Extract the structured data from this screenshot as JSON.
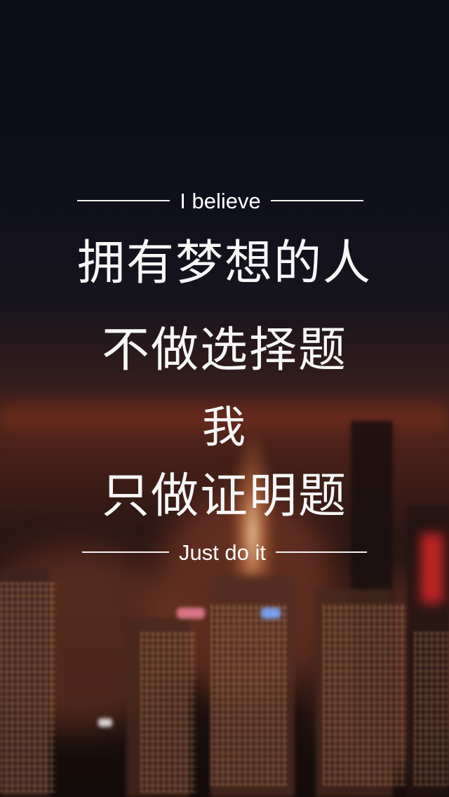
{
  "wallpaper": {
    "top_caption": "I believe",
    "bottom_caption": "Just do it",
    "quote_lines": [
      "拥有梦想的人",
      "不做选择题",
      "我",
      "只做证明题"
    ],
    "background_scene": "blurred-night-city-skyline",
    "colors": {
      "sky": "#0b0d19",
      "city_glow": "#4a2219",
      "text": "#ffffff"
    }
  }
}
